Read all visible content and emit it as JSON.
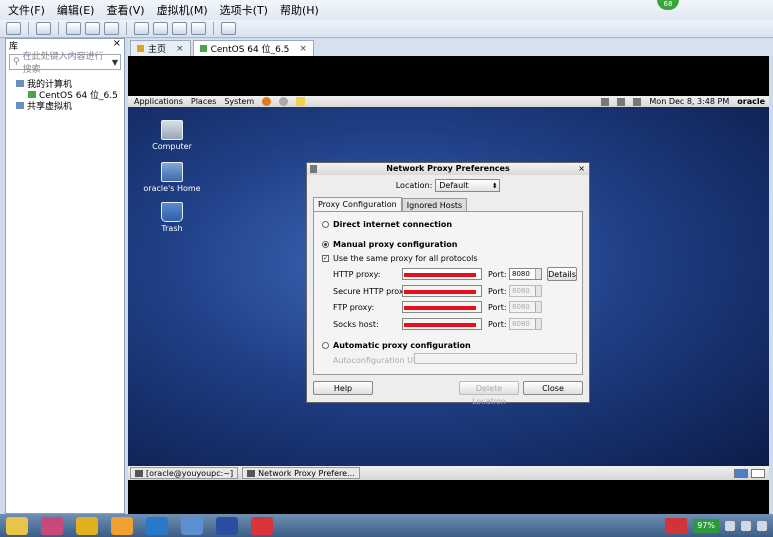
{
  "host": {
    "menu": [
      "文件(F)",
      "编辑(E)",
      "查看(V)",
      "虚拟机(M)",
      "选项卡(T)",
      "帮助(H)"
    ],
    "badge": "68"
  },
  "library": {
    "title": "库",
    "search_placeholder": "在此处键入内容进行搜索",
    "tree": [
      "我的计算机",
      "CentOS 64 位_6.5",
      "共享虚拟机"
    ]
  },
  "tabs": [
    {
      "label": "主页"
    },
    {
      "label": "CentOS 64 位_6.5"
    }
  ],
  "guest_panel": {
    "menus": [
      "Applications",
      "Places",
      "System"
    ],
    "clock": "Mon Dec  8,  3:48 PM",
    "user": "oracle"
  },
  "desktop_icons": [
    "Computer",
    "oracle's Home",
    "Trash"
  ],
  "guest_tasks": [
    "[oracle@youyoupc:~]",
    "Network Proxy Prefere..."
  ],
  "dialog": {
    "title": "Network Proxy Preferences",
    "location_label": "Location:",
    "location_value": "Default",
    "tabs": [
      "Proxy Configuration",
      "Ignored Hosts"
    ],
    "direct": "Direct internet connection",
    "manual": "Manual proxy configuration",
    "same_proxy": "Use the same proxy for all protocols",
    "http_label": "HTTP proxy:",
    "secure_label": "Secure HTTP proxy:",
    "ftp_label": "FTP proxy:",
    "socks_label": "Socks host:",
    "port_label": "Port:",
    "http_port": "8080",
    "secure_port": "8080",
    "ftp_port": "8080",
    "socks_port": "8080",
    "details": "Details",
    "auto": "Automatic proxy configuration",
    "auto_url_label": "Autoconfiguration URL:",
    "help": "Help",
    "delete_location": "Delete Location",
    "close": "Close"
  },
  "win_taskbar": {
    "battery": "97%"
  }
}
